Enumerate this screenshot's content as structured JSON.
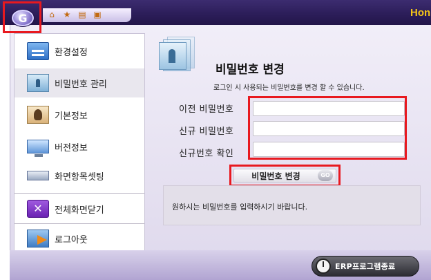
{
  "header": {
    "logo_letter": "G",
    "home_label": "Hon",
    "quick_icons": [
      "home-icon",
      "star-icon",
      "document-icon",
      "folder-icon"
    ]
  },
  "sidebar": {
    "items": [
      {
        "label": "환경설정",
        "icon": "settings-icon"
      },
      {
        "label": "비밀번호 관리",
        "icon": "password-icon",
        "active": true
      },
      {
        "label": "기본정보",
        "icon": "user-info-icon"
      },
      {
        "label": "버전정보",
        "icon": "monitor-icon"
      },
      {
        "label": "화면항목셋팅",
        "icon": "screen-setting-icon"
      },
      {
        "label": "전체화면닫기",
        "icon": "close-all-icon"
      },
      {
        "label": "로그아웃",
        "icon": "logout-icon"
      }
    ]
  },
  "main": {
    "title": "비밀번호 변경",
    "subtitle": "로그인 시 사용되는 비밀번호를 변경 할 수 있습니다.",
    "fields": [
      {
        "label": "이전 비밀번호",
        "value": ""
      },
      {
        "label": "신규 비밀번호",
        "value": ""
      },
      {
        "label": "신규번호 확인",
        "value": ""
      }
    ],
    "submit_label": "비밀번호 변경",
    "go_label": "GO",
    "message": "원하시는 비밀번호를 입력하시기 바랍니다."
  },
  "footer": {
    "exit_label": "ERP프로그램종료"
  },
  "colors": {
    "header_bg": "#2b1d58",
    "highlight_box": "#e8191f",
    "home_text": "#f5c518"
  }
}
